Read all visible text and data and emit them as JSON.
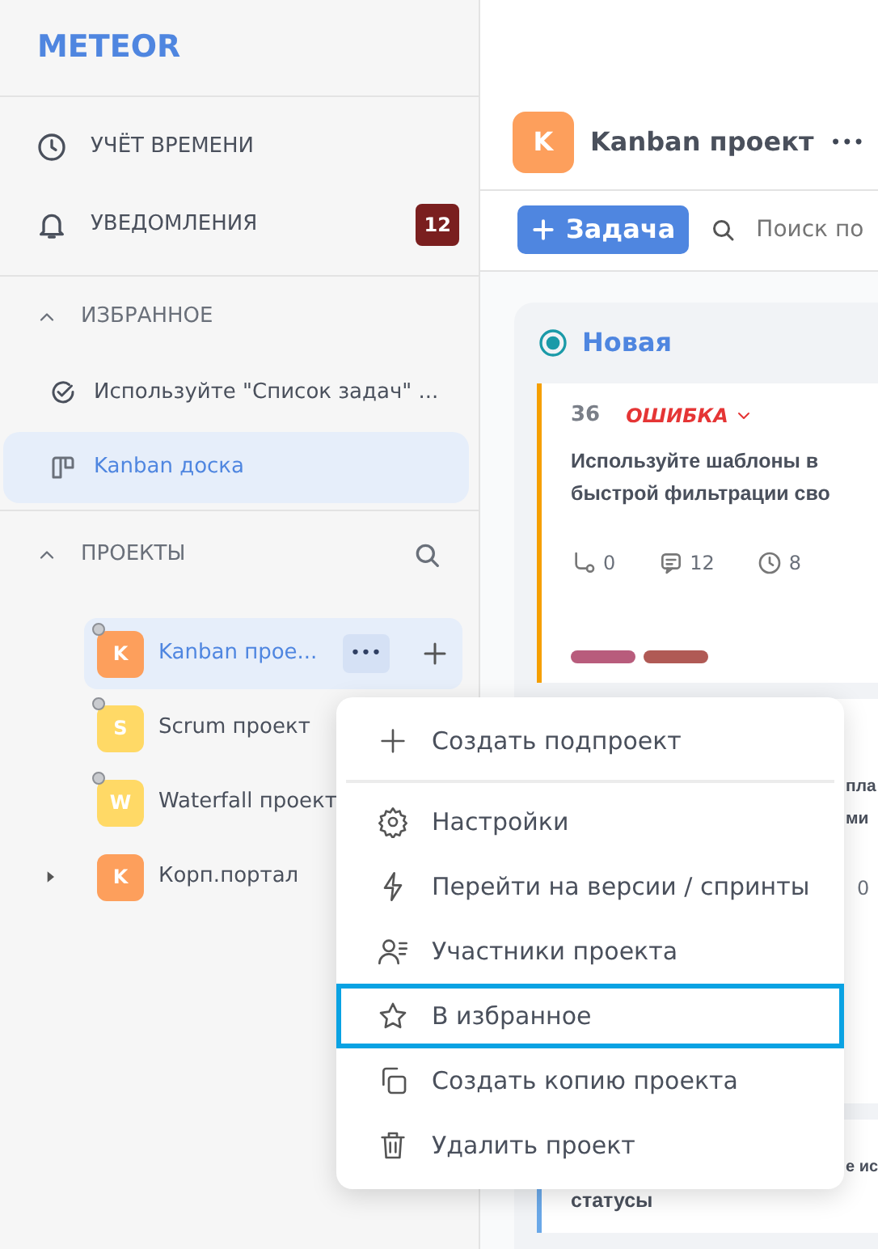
{
  "logo": "METEOR",
  "nav": [
    {
      "label": "УЧЁТ ВРЕМЕНИ"
    },
    {
      "label": "УВЕДОМЛЕНИЯ",
      "badge": "12"
    }
  ],
  "favorites": {
    "title": "ИЗБРАННОЕ",
    "expanded": true,
    "items": [
      {
        "kind": "task",
        "label": "Используйте \"Список задач\" ...",
        "selected": false
      },
      {
        "kind": "board",
        "label": "Kanban доска",
        "selected": true
      }
    ]
  },
  "projects": {
    "title": "ПРОЕКТЫ",
    "expanded": true,
    "items": [
      {
        "letter": "K",
        "label": "Kanban прое...",
        "color": "#fd9f5c",
        "selected": true,
        "status_dot": true,
        "has_children": false,
        "actions": {
          "more": "•••"
        }
      },
      {
        "letter": "S",
        "label": "Scrum проект",
        "color": "#ffd966",
        "selected": false,
        "status_dot": true,
        "has_children": false
      },
      {
        "letter": "W",
        "label": "Waterfall проект",
        "color": "#ffd966",
        "selected": false,
        "status_dot": true,
        "has_children": false
      },
      {
        "letter": "K",
        "label": "Корп.портал",
        "color": "#fd9f5c",
        "selected": false,
        "status_dot": false,
        "has_children": true,
        "expanded": false
      }
    ]
  },
  "header": {
    "letter": "K",
    "color": "#fd9f5c",
    "title": "Kanban проект",
    "more": "•••"
  },
  "toolbar": {
    "add_label": "Задача",
    "search_placeholder": "Поиск по"
  },
  "column": {
    "title": "Новая",
    "cards": [
      {
        "kind": "full",
        "color": "#f59f00",
        "number": "36",
        "type": "ОШИБКА",
        "title_lines": [
          "Используйте шаблоны в",
          "быстрой фильтрации сво"
        ],
        "stats": [
          "0",
          "12",
          "8"
        ],
        "tags": [
          {
            "color": "#b85c7c"
          },
          {
            "color": "#b05a55"
          }
        ]
      },
      {
        "kind": "partial",
        "title_lines": [
          "пла",
          "ми"
        ],
        "stats": [
          "0"
        ]
      },
      {
        "kind": "partial_bottom",
        "color": "#6aa8e8",
        "title_lines": [
          "е ис",
          "статусы"
        ]
      }
    ]
  },
  "menu": [
    {
      "label": "Создать подпроект",
      "selected": false,
      "divider_after": true
    },
    {
      "label": "Настройки",
      "selected": false,
      "divider_after": false
    },
    {
      "label": "Перейти на версии / спринты",
      "selected": false,
      "divider_after": false
    },
    {
      "label": "Участники проекта",
      "selected": false,
      "divider_after": false
    },
    {
      "label": "В избранное",
      "selected": true,
      "divider_after": false
    },
    {
      "label": "Создать копию проекта",
      "selected": false,
      "divider_after": false
    },
    {
      "label": "Удалить проект",
      "selected": false,
      "divider_after": false
    }
  ]
}
